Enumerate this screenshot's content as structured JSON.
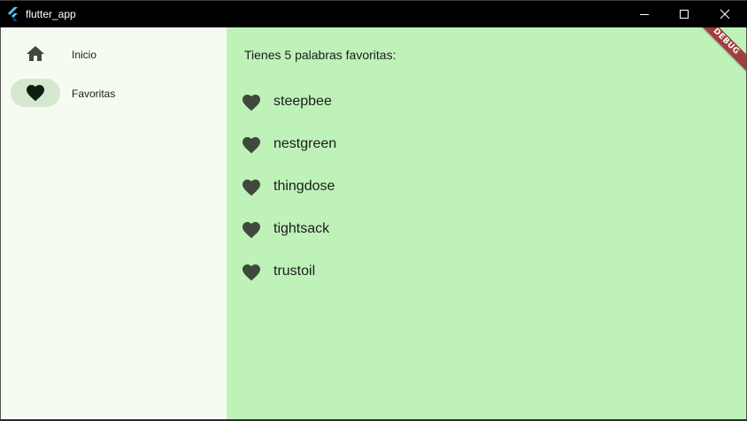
{
  "window": {
    "title": "flutter_app",
    "app_icon": "flutter-logo-icon",
    "controls": [
      "minimize-icon",
      "maximize-icon",
      "close-icon"
    ]
  },
  "sidebar": {
    "items": [
      {
        "label": "Inicio",
        "icon": "home-icon",
        "selected": false
      },
      {
        "label": "Favoritas",
        "icon": "heart-icon",
        "selected": true
      }
    ],
    "colors": {
      "background": "#f6fbf1",
      "selected_pill": "#d6e7d0"
    }
  },
  "main": {
    "summary": "Tienes 5 palabras favoritas:",
    "favorites": [
      {
        "word": "steepbee",
        "icon": "heart-icon"
      },
      {
        "word": "nestgreen",
        "icon": "heart-icon"
      },
      {
        "word": "thingdose",
        "icon": "heart-icon"
      },
      {
        "word": "tightsack",
        "icon": "heart-icon"
      },
      {
        "word": "trustoil",
        "icon": "heart-icon"
      }
    ],
    "colors": {
      "background": "#bff2b8",
      "icon": "#3f4a3c"
    }
  },
  "debug_banner": {
    "label": "DEBUG",
    "color": "#a13e3e"
  }
}
